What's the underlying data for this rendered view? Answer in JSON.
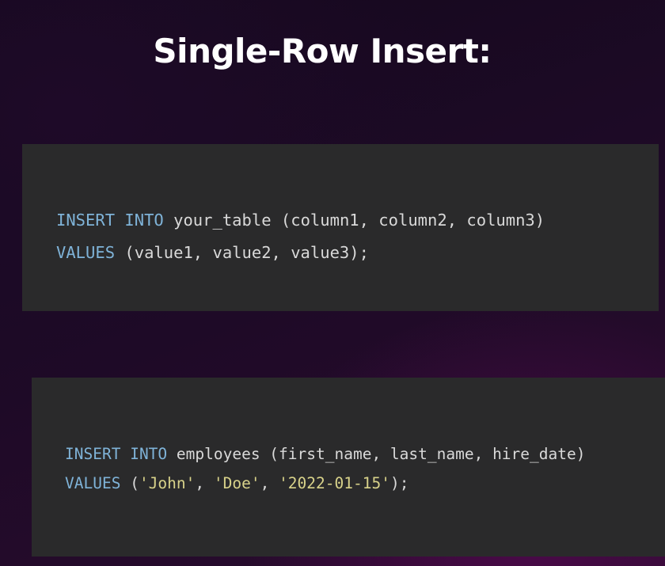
{
  "slide": {
    "title": "Single-Row Insert:"
  },
  "code_blocks": [
    {
      "lines": [
        {
          "keyword1": "INSERT",
          "sp1": " ",
          "keyword2": "INTO",
          "rest": " your_table (column1, column2, column3)"
        },
        {
          "keyword1": "VALUES",
          "rest": " (value1, value2, value3);"
        }
      ]
    },
    {
      "lines": [
        {
          "keyword1": "INSERT",
          "sp1": " ",
          "keyword2": "INTO",
          "rest": " employees (first_name, last_name, hire_date)"
        },
        {
          "keyword1": "VALUES",
          "p1": " (",
          "s1": "'John'",
          "p2": ", ",
          "s2": "'Doe'",
          "p3": ", ",
          "s3": "'2022-01-15'",
          "p4": ");"
        }
      ]
    }
  ],
  "colors": {
    "keyword": "#7fb3d8",
    "string": "#d8d28a",
    "text": "#d9d9d9",
    "code_background": "#2a2a2b"
  }
}
